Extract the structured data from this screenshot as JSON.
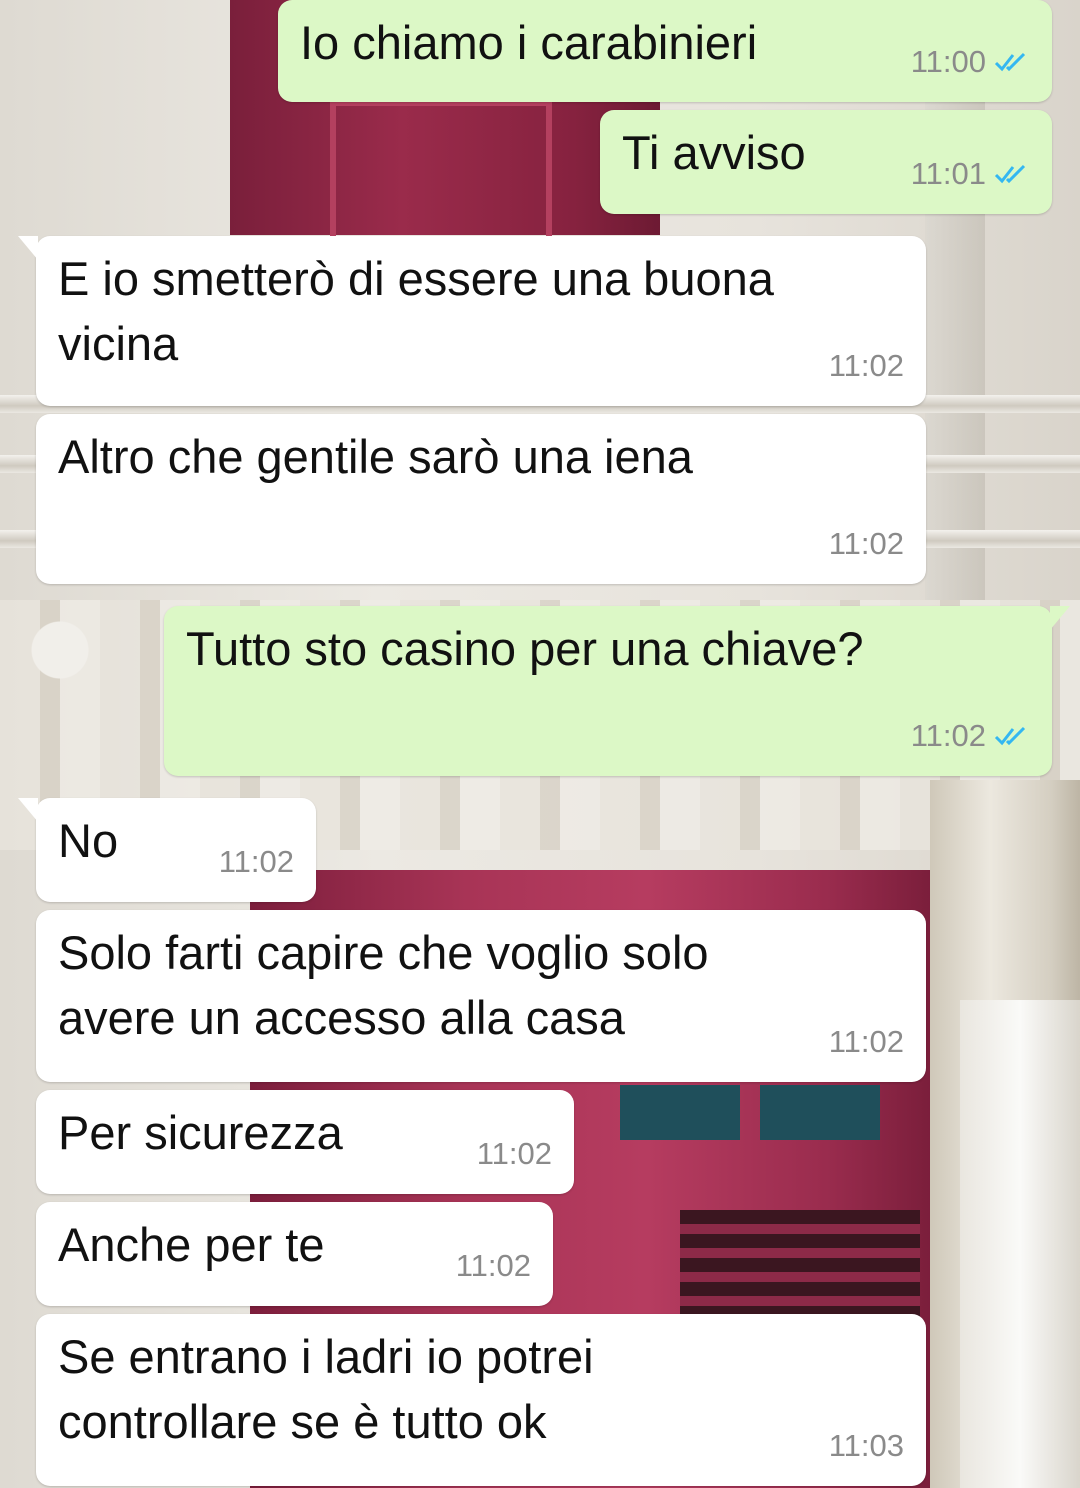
{
  "colors": {
    "outgoing_bubble": "#dcf8c6",
    "incoming_bubble": "#ffffff",
    "read_ticks": "#34b7f1",
    "timestamp": "#8a8a8a"
  },
  "messages": [
    {
      "direction": "outgoing",
      "text": "Io chiamo i carabinieri",
      "time": "11:00",
      "status_icon": "double-check-icon"
    },
    {
      "direction": "outgoing",
      "text": "Ti avviso",
      "time": "11:01",
      "status_icon": "double-check-icon"
    },
    {
      "direction": "incoming",
      "text": "E io smetterò di essere una buona\nvicina",
      "time": "11:02"
    },
    {
      "direction": "incoming",
      "text": "Altro che gentile sarò una iena",
      "time": "11:02"
    },
    {
      "direction": "outgoing",
      "text": "Tutto sto casino per una chiave?",
      "time": "11:02",
      "status_icon": "double-check-icon"
    },
    {
      "direction": "incoming",
      "text": "No",
      "time": "11:02"
    },
    {
      "direction": "incoming",
      "text": "Solo farti capire che voglio solo\navere un accesso alla casa",
      "time": "11:02"
    },
    {
      "direction": "incoming",
      "text": "Per sicurezza",
      "time": "11:02"
    },
    {
      "direction": "incoming",
      "text": "Anche per te",
      "time": "11:02"
    },
    {
      "direction": "incoming",
      "text": "Se entrano i ladri io potrei\ncontrollare se è tutto ok",
      "time": "11:03"
    }
  ]
}
